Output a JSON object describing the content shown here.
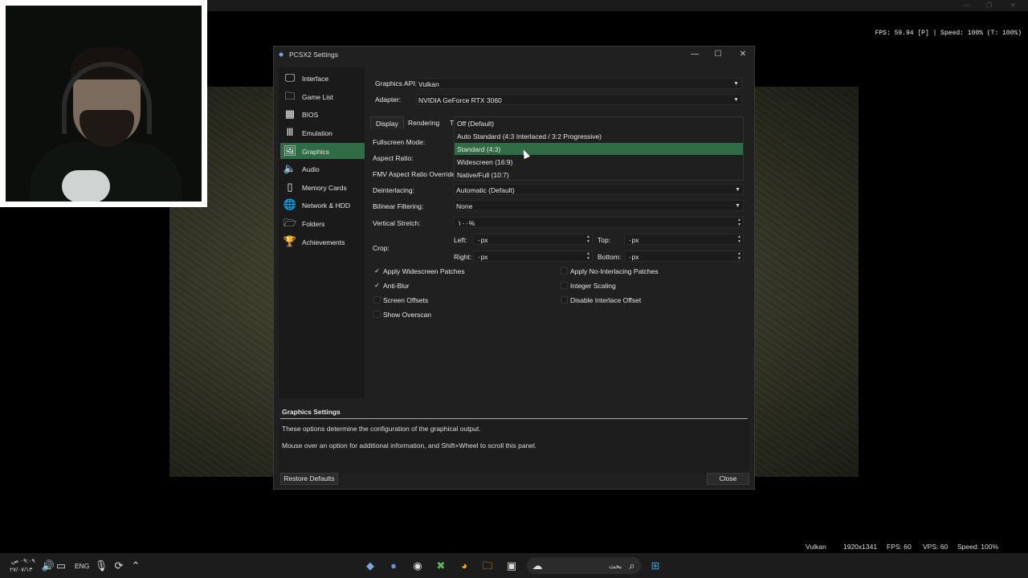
{
  "emulator": {
    "overlay": "FPS: 59.94 [P] | Speed: 100% (T: 100%)"
  },
  "dialog": {
    "title": "PCSX2 Settings",
    "icons": {
      "app": "pcsx2-logo-icon",
      "minimize": "minimize-icon",
      "maximize": "maximize-icon",
      "close": "close-icon"
    }
  },
  "sidebar": {
    "items": [
      {
        "label": "Interface",
        "icon": "monitor-icon",
        "active": false
      },
      {
        "label": "Game List",
        "icon": "folder-icon",
        "active": false
      },
      {
        "label": "BIOS",
        "icon": "chip-icon",
        "active": false
      },
      {
        "label": "Emulation",
        "icon": "pillar-icon",
        "active": false
      },
      {
        "label": "Graphics",
        "icon": "image-icon",
        "active": true
      },
      {
        "label": "Audio",
        "icon": "speaker-icon",
        "active": false
      },
      {
        "label": "Memory Cards",
        "icon": "sd-card-icon",
        "active": false
      },
      {
        "label": "Network & HDD",
        "icon": "globe-icon",
        "active": false
      },
      {
        "label": "Folders",
        "icon": "folder-settings-icon",
        "active": false
      },
      {
        "label": "Achievements",
        "icon": "trophy-icon",
        "active": false
      }
    ]
  },
  "graphics": {
    "api_label": "Graphics API:",
    "api_value": "Vulkan",
    "adapter_label": "Adapter:",
    "adapter_value": "NVIDIA GeForce RTX 3060",
    "tabs": [
      "Display",
      "Rendering",
      "T"
    ],
    "fullscreen_label": "Fullscreen Mode:",
    "aspect_label": "Aspect Ratio:",
    "fmv_label": "FMV Aspect Ratio Override:",
    "deinterlacing_label": "Deinterlacing:",
    "deinterlacing_value": "Automatic (Default)",
    "bilinear_label": "Bilinear Filtering:",
    "bilinear_value": "None",
    "vstretch_label": "Vertical Stretch:",
    "vstretch_value": "١٠٠%",
    "crop_label": "Crop:",
    "crop": {
      "left_label": "Left:",
      "left_value": "٠px",
      "top_label": "Top:",
      "top_value": "٠px",
      "right_label": "Right:",
      "right_value": "٠px",
      "bottom_label": "Bottom:",
      "bottom_value": "٠px"
    },
    "checks_left": [
      {
        "label": "Apply Widescreen Patches",
        "checked": true
      },
      {
        "label": "Anti-Blur",
        "checked": true
      },
      {
        "label": "Screen Offsets",
        "checked": false
      },
      {
        "label": "Show Overscan",
        "checked": false
      }
    ],
    "checks_right": [
      {
        "label": "Apply No-Interlacing Patches",
        "checked": false
      },
      {
        "label": "Integer Scaling",
        "checked": false
      },
      {
        "label": "Disable Interlace Offset",
        "checked": false
      }
    ],
    "dropdown_options": [
      {
        "label": "Off (Default)",
        "selected": false
      },
      {
        "label": "Auto Standard (4:3 Interlaced / 3:2 Progressive)",
        "selected": false
      },
      {
        "label": "Standard (4:3)",
        "selected": true
      },
      {
        "label": "Widescreen (16:9)",
        "selected": false
      },
      {
        "label": "Native/Full (10:7)",
        "selected": false
      }
    ]
  },
  "info": {
    "title": "Graphics Settings",
    "line1": "These options determine the configuration of the graphical output.",
    "line2": "Mouse over an option for additional information, and Shift+Wheel to scroll this panel."
  },
  "buttons": {
    "restore": "Restore Defaults",
    "close": "Close"
  },
  "statusbar": {
    "renderer": "Vulkan",
    "resolution": "1920x1341",
    "fps": "FPS: 60",
    "vps": "VPS: 60",
    "speed": "Speed: 100%"
  },
  "taskbar": {
    "time": "٠٩:٠٩ ص",
    "date": "٢٧/٠٧/١٣",
    "lang": "ENG",
    "search_placeholder": "بحث"
  },
  "colors": {
    "accent": "#2f6b45",
    "dialog_bg": "#202020",
    "sidebar_bg": "#1a1a1a"
  }
}
